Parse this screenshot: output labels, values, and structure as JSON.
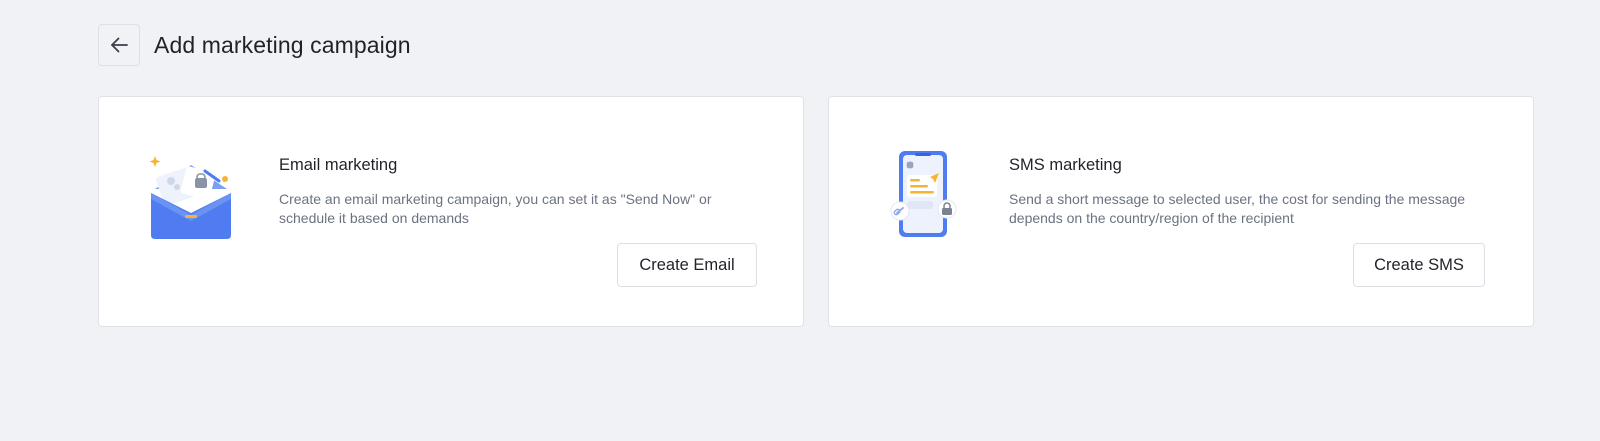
{
  "page": {
    "title": "Add marketing campaign"
  },
  "icons": {
    "back": "arrow-left-icon",
    "email": "email-envelope-illustration",
    "sms": "phone-sms-illustration"
  },
  "colors": {
    "background": "#f0f2f5",
    "card": "#ffffff",
    "accent_blue": "#4f7cf0",
    "accent_yellow": "#f5b533"
  },
  "cards": [
    {
      "title": "Email marketing",
      "description": "Create an email marketing campaign, you can set it as \"Send Now\" or schedule it based on demands",
      "button_label": "Create Email"
    },
    {
      "title": "SMS marketing",
      "description": "Send a short message to selected user, the cost for sending the message depends on the country/region of the recipient",
      "button_label": "Create SMS"
    }
  ]
}
